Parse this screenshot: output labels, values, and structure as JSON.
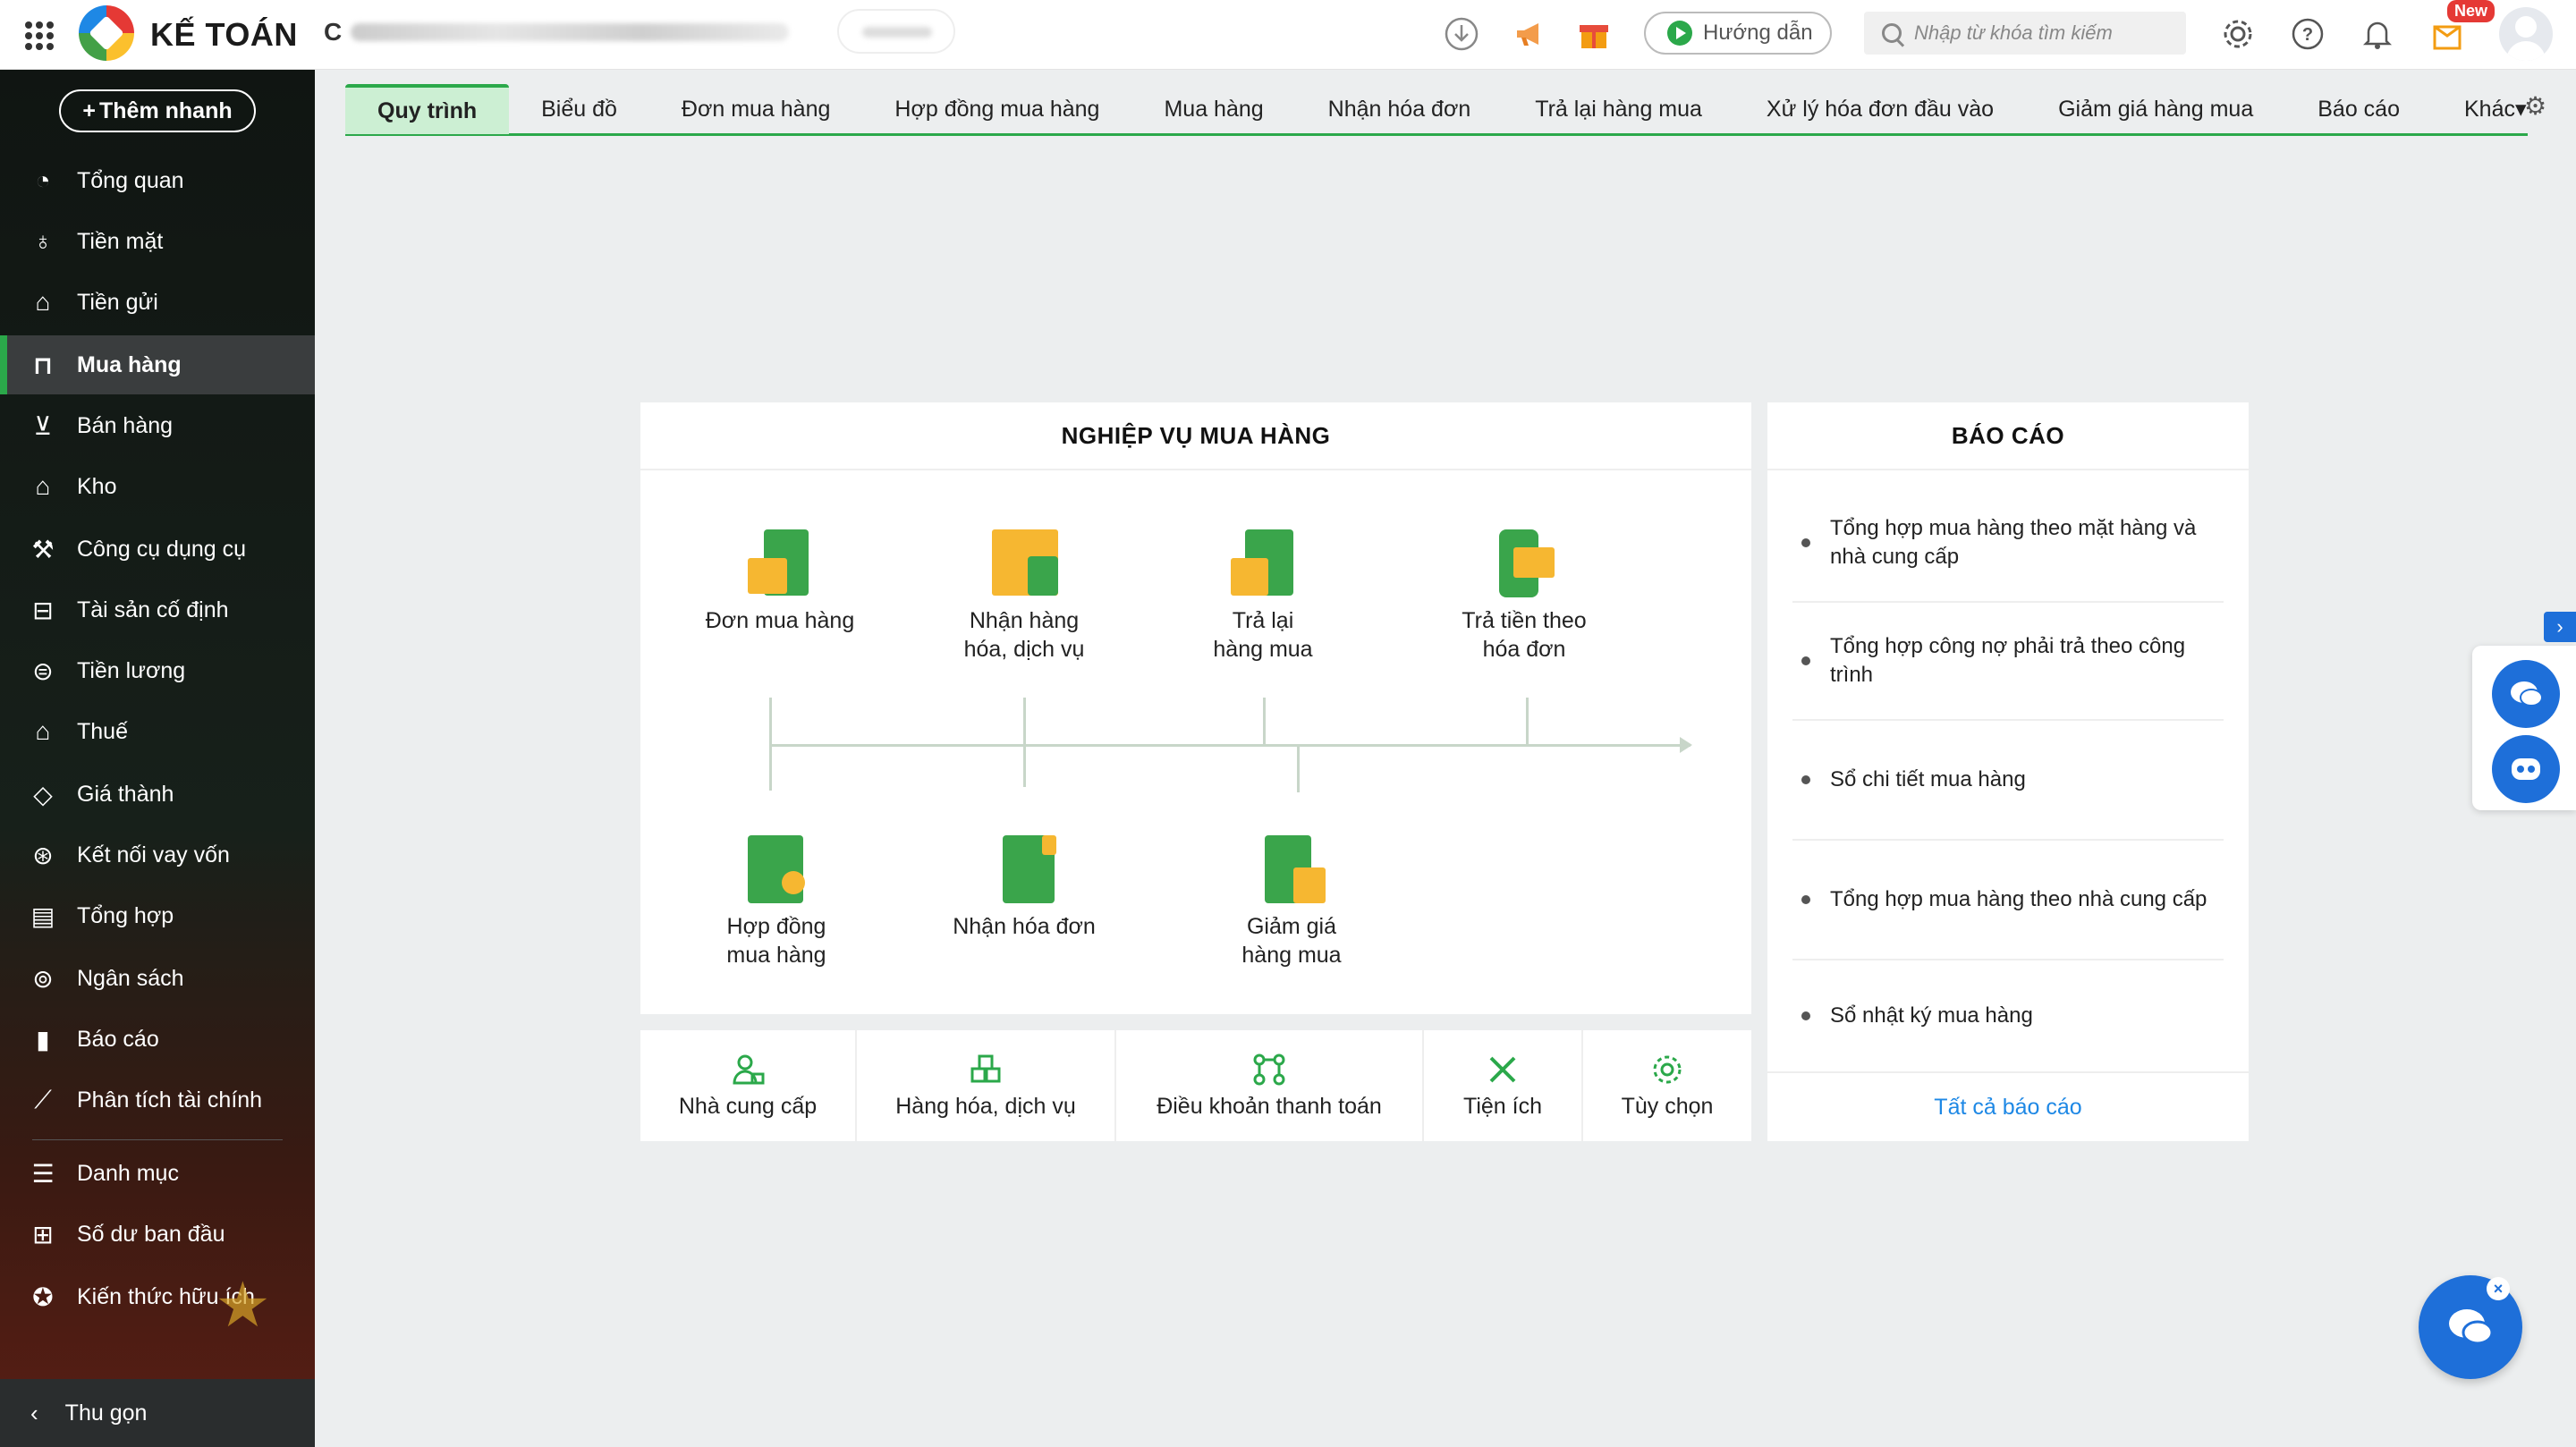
{
  "app": {
    "brand": "KẾ TOÁN",
    "company_prefix": "C",
    "guide_label": "Hướng dẫn",
    "search_placeholder": "Nhập từ khóa tìm kiếm",
    "new_badge": "New"
  },
  "sidebar": {
    "add_quick": "Thêm nhanh",
    "items": [
      {
        "label": "Tổng quan",
        "icon": "chart-pie-icon"
      },
      {
        "label": "Tiền mặt",
        "icon": "money-bag-icon"
      },
      {
        "label": "Tiền gửi",
        "icon": "bank-icon"
      },
      {
        "label": "Mua hàng",
        "icon": "shopping-bag-icon"
      },
      {
        "label": "Bán hàng",
        "icon": "cart-icon"
      },
      {
        "label": "Kho",
        "icon": "warehouse-icon"
      },
      {
        "label": "Công cụ dụng cụ",
        "icon": "tools-icon"
      },
      {
        "label": "Tài sản cố định",
        "icon": "car-icon"
      },
      {
        "label": "Tiền lương",
        "icon": "payroll-icon"
      },
      {
        "label": "Thuế",
        "icon": "tax-icon"
      },
      {
        "label": "Giá thành",
        "icon": "price-tag-icon"
      },
      {
        "label": "Kết nối vay vốn",
        "icon": "loan-icon"
      },
      {
        "label": "Tổng hợp",
        "icon": "summary-icon"
      },
      {
        "label": "Ngân sách",
        "icon": "budget-icon"
      },
      {
        "label": "Báo cáo",
        "icon": "report-bars-icon"
      },
      {
        "label": "Phân tích tài chính",
        "icon": "analysis-icon"
      },
      {
        "label": "Danh mục",
        "icon": "list-icon"
      },
      {
        "label": "Số dư ban đầu",
        "icon": "balance-icon"
      },
      {
        "label": "Kiến thức hữu ích",
        "icon": "knowledge-icon"
      }
    ],
    "active": "Mua hàng",
    "collapse": "Thu gọn"
  },
  "tabs": [
    "Quy trình",
    "Biểu đồ",
    "Đơn mua hàng",
    "Hợp đồng mua hàng",
    "Mua hàng",
    "Nhận hóa đơn",
    "Trả lại hàng mua",
    "Xử lý hóa đơn đầu vào",
    "Giảm giá hàng mua",
    "Báo cáo",
    "Khác"
  ],
  "process": {
    "title": "NGHIỆP VỤ MUA HÀNG",
    "top": [
      "Đơn mua hàng",
      "Nhận hàng hóa, dịch vụ",
      "Trả lại hàng mua",
      "Trả tiền theo hóa đơn"
    ],
    "bottom": [
      "Hợp đồng mua hàng",
      "Nhận hóa đơn",
      "Giảm giá hàng mua"
    ]
  },
  "bottom_bar": [
    {
      "label": "Nhà cung cấp",
      "icon": "supplier-icon"
    },
    {
      "label": "Hàng hóa, dịch vụ",
      "icon": "goods-icon"
    },
    {
      "label": "Điều khoản thanh toán",
      "icon": "payment-terms-icon"
    },
    {
      "label": "Tiện ích",
      "icon": "utilities-icon"
    },
    {
      "label": "Tùy chọn",
      "icon": "settings-gear-icon"
    }
  ],
  "reports": {
    "title": "BÁO CÁO",
    "items": [
      "Tổng hợp mua hàng theo mặt hàng và nhà cung cấp",
      "Tổng hợp công nợ phải trả theo công trình",
      "Sổ chi tiết mua hàng",
      "Tổng hợp mua hàng theo nhà cung cấp",
      "Sổ nhật ký mua hàng"
    ],
    "all": "Tất cả báo cáo"
  },
  "colors": {
    "accent": "#2ba84a",
    "link": "#1e88e5",
    "float": "#1e6fd9"
  }
}
